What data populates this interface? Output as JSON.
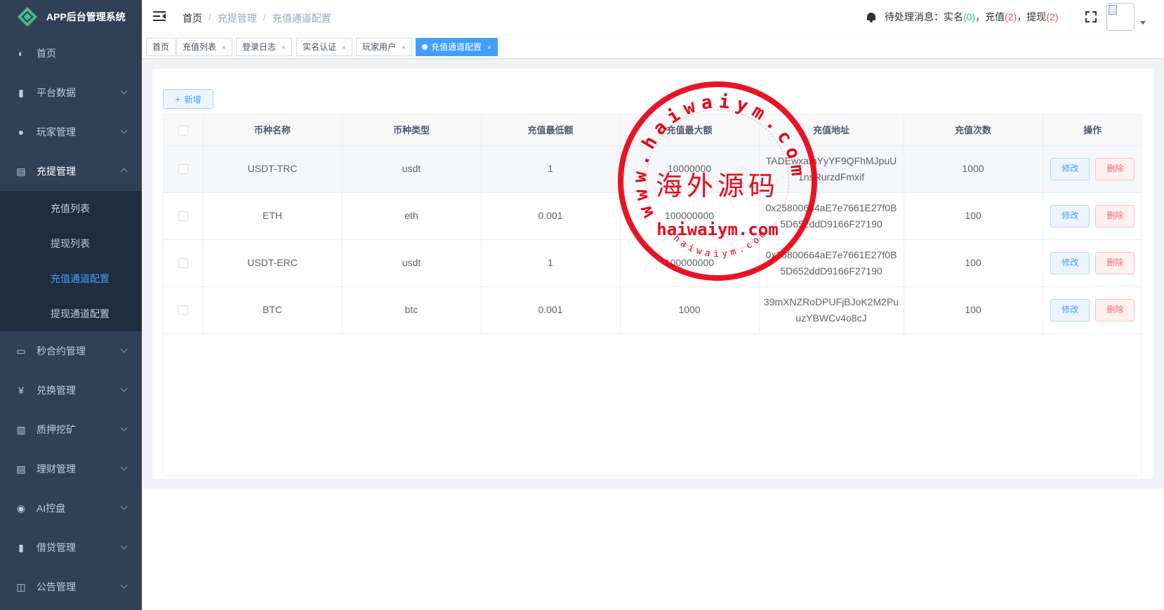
{
  "app": {
    "title": "APP后台管理系统"
  },
  "sidebar": {
    "items": [
      {
        "label": "首页",
        "icon": "dashboard-icon",
        "has_children": false
      },
      {
        "label": "平台数据",
        "icon": "book-icon",
        "has_children": true
      },
      {
        "label": "玩家管理",
        "icon": "user-icon",
        "has_children": true
      },
      {
        "label": "充提管理",
        "icon": "document-icon",
        "has_children": true,
        "open": true,
        "children": [
          {
            "label": "充值列表",
            "active": false
          },
          {
            "label": "提现列表",
            "active": false
          },
          {
            "label": "充值通道配置",
            "active": true
          },
          {
            "label": "提现通道配置",
            "active": false
          }
        ]
      },
      {
        "label": "秒合约管理",
        "icon": "monitor-icon",
        "has_children": true
      },
      {
        "label": "兑换管理",
        "icon": "yen-icon",
        "has_children": true
      },
      {
        "label": "质押挖矿",
        "icon": "bar-chart-icon",
        "has_children": true
      },
      {
        "label": "理财管理",
        "icon": "list-doc-icon",
        "has_children": true
      },
      {
        "label": "AI控盘",
        "icon": "robot-icon",
        "has_children": true
      },
      {
        "label": "借贷管理",
        "icon": "book-icon",
        "has_children": true
      },
      {
        "label": "公告管理",
        "icon": "open-book-icon",
        "has_children": true
      }
    ]
  },
  "navbar": {
    "breadcrumb": [
      "首页",
      "充提管理",
      "充值通道配置"
    ],
    "notice": {
      "label": "待处理消息：",
      "items": [
        {
          "label": "实名",
          "count": "0",
          "color": "#13ce66"
        },
        {
          "label": "充值",
          "count": "2",
          "color": "#ff4949"
        },
        {
          "label": "提现",
          "count": "2",
          "color": "#ff4949"
        }
      ]
    }
  },
  "tags": [
    {
      "label": "首页",
      "closable": false,
      "active": false
    },
    {
      "label": "充值列表",
      "closable": true,
      "active": false
    },
    {
      "label": "登录日志",
      "closable": true,
      "active": false
    },
    {
      "label": "实名认证",
      "closable": true,
      "active": false
    },
    {
      "label": "玩家用户",
      "closable": true,
      "active": false
    },
    {
      "label": "充值通道配置",
      "closable": true,
      "active": true
    }
  ],
  "toolbar": {
    "add_label": "新增"
  },
  "table": {
    "columns": [
      "",
      "币种名称",
      "币种类型",
      "充值最低额",
      "充值最大额",
      "充值地址",
      "充值次数",
      "操作"
    ],
    "rows": [
      {
        "name": "USDT-TRC",
        "type": "usdt",
        "min": "1",
        "max": "10000000",
        "address": "TADEwxamYyYF9QFhMJpuU1nsRurzdFmxif",
        "count": "1000"
      },
      {
        "name": "ETH",
        "type": "eth",
        "min": "0.001",
        "max": "100000000",
        "address": "0x25800664aE7e7661E27f0B5D652ddD9166F27190",
        "count": "100"
      },
      {
        "name": "USDT-ERC",
        "type": "usdt",
        "min": "1",
        "max": "100000000",
        "address": "0x25800664aE7e7661E27f0B5D652ddD9166F27190",
        "count": "100"
      },
      {
        "name": "BTC",
        "type": "btc",
        "min": "0.001",
        "max": "1000",
        "address": "39mXNZRoDPUFjBJoK2M2PuuzYBWCv4o8cJ",
        "count": "100"
      }
    ],
    "actions": {
      "edit": "修改",
      "delete": "删除"
    }
  },
  "stamp": {
    "center_text": "海外源码",
    "domain_text": "haiwaiym.com",
    "ring_text": "www.haiwaiym.com",
    "inner_ring_text": "haiwaiym.com",
    "color": "#e60012"
  }
}
